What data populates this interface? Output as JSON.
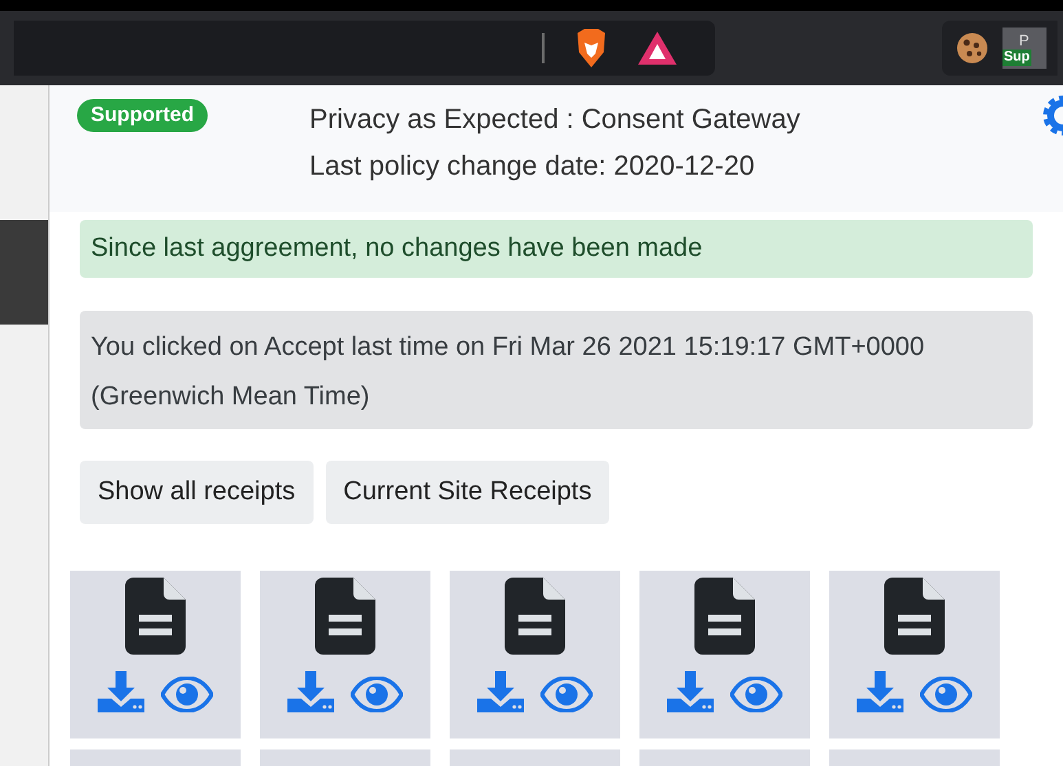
{
  "toolbar": {
    "extension_label": "P",
    "extension_badge": "Sup"
  },
  "popup": {
    "badge": "Supported",
    "title": "Privacy as Expected : Consent Gateway",
    "policy_date": "Last policy change date: 2020-12-20",
    "status_message": "Since last aggreement, no changes have been made",
    "last_action": "You clicked on Accept last time on Fri Mar 26 2021 15:19:17 GMT+0000 (Greenwich Mean Time)",
    "buttons": [
      "Show all receipts",
      "Current Site Receipts"
    ],
    "receipts": [
      {
        "kind": "document"
      },
      {
        "kind": "document"
      },
      {
        "kind": "document"
      },
      {
        "kind": "document"
      },
      {
        "kind": "document"
      }
    ]
  }
}
